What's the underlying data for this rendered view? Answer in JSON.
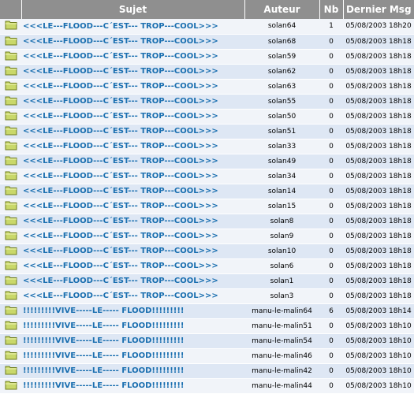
{
  "header": {
    "sujet": "Sujet",
    "auteur": "Auteur",
    "nb": "Nb",
    "dernier": "Dernier Msg"
  },
  "rows": [
    {
      "subject": "<<<LE---FLOOD---C´EST--- TROP---COOL>>>",
      "author": "solan64",
      "nb": "1",
      "date": "05/08/2003 18h20"
    },
    {
      "subject": "<<<LE---FLOOD---C´EST--- TROP---COOL>>>",
      "author": "solan68",
      "nb": "0",
      "date": "05/08/2003 18h18"
    },
    {
      "subject": "<<<LE---FLOOD---C´EST--- TROP---COOL>>>",
      "author": "solan59",
      "nb": "0",
      "date": "05/08/2003 18h18"
    },
    {
      "subject": "<<<LE---FLOOD---C´EST--- TROP---COOL>>>",
      "author": "solan62",
      "nb": "0",
      "date": "05/08/2003 18h18"
    },
    {
      "subject": "<<<LE---FLOOD---C´EST--- TROP---COOL>>>",
      "author": "solan63",
      "nb": "0",
      "date": "05/08/2003 18h18"
    },
    {
      "subject": "<<<LE---FLOOD---C´EST--- TROP---COOL>>>",
      "author": "solan55",
      "nb": "0",
      "date": "05/08/2003 18h18"
    },
    {
      "subject": "<<<LE---FLOOD---C´EST--- TROP---COOL>>>",
      "author": "solan50",
      "nb": "0",
      "date": "05/08/2003 18h18"
    },
    {
      "subject": "<<<LE---FLOOD---C´EST--- TROP---COOL>>>",
      "author": "solan51",
      "nb": "0",
      "date": "05/08/2003 18h18"
    },
    {
      "subject": "<<<LE---FLOOD---C´EST--- TROP---COOL>>>",
      "author": "solan33",
      "nb": "0",
      "date": "05/08/2003 18h18"
    },
    {
      "subject": "<<<LE---FLOOD---C´EST--- TROP---COOL>>>",
      "author": "solan49",
      "nb": "0",
      "date": "05/08/2003 18h18"
    },
    {
      "subject": "<<<LE---FLOOD---C´EST--- TROP---COOL>>>",
      "author": "solan34",
      "nb": "0",
      "date": "05/08/2003 18h18"
    },
    {
      "subject": "<<<LE---FLOOD---C´EST--- TROP---COOL>>>",
      "author": "solan14",
      "nb": "0",
      "date": "05/08/2003 18h18"
    },
    {
      "subject": "<<<LE---FLOOD---C´EST--- TROP---COOL>>>",
      "author": "solan15",
      "nb": "0",
      "date": "05/08/2003 18h18"
    },
    {
      "subject": "<<<LE---FLOOD---C´EST--- TROP---COOL>>>",
      "author": "solan8",
      "nb": "0",
      "date": "05/08/2003 18h18"
    },
    {
      "subject": "<<<LE---FLOOD---C´EST--- TROP---COOL>>>",
      "author": "solan9",
      "nb": "0",
      "date": "05/08/2003 18h18"
    },
    {
      "subject": "<<<LE---FLOOD---C´EST--- TROP---COOL>>>",
      "author": "solan10",
      "nb": "0",
      "date": "05/08/2003 18h18"
    },
    {
      "subject": "<<<LE---FLOOD---C´EST--- TROP---COOL>>>",
      "author": "solan6",
      "nb": "0",
      "date": "05/08/2003 18h18"
    },
    {
      "subject": "<<<LE---FLOOD---C´EST--- TROP---COOL>>>",
      "author": "solan1",
      "nb": "0",
      "date": "05/08/2003 18h18"
    },
    {
      "subject": "<<<LE---FLOOD---C´EST--- TROP---COOL>>>",
      "author": "solan3",
      "nb": "0",
      "date": "05/08/2003 18h18"
    },
    {
      "subject": "!!!!!!!!!VIVE-----LE----- FLOOD!!!!!!!!!",
      "author": "manu-le-malin64",
      "nb": "6",
      "date": "05/08/2003 18h14"
    },
    {
      "subject": "!!!!!!!!!VIVE-----LE----- FLOOD!!!!!!!!!",
      "author": "manu-le-malin51",
      "nb": "0",
      "date": "05/08/2003 18h10"
    },
    {
      "subject": "!!!!!!!!!VIVE-----LE----- FLOOD!!!!!!!!!",
      "author": "manu-le-malin54",
      "nb": "0",
      "date": "05/08/2003 18h10"
    },
    {
      "subject": "!!!!!!!!!VIVE-----LE----- FLOOD!!!!!!!!!",
      "author": "manu-le-malin46",
      "nb": "0",
      "date": "05/08/2003 18h10"
    },
    {
      "subject": "!!!!!!!!!VIVE-----LE----- FLOOD!!!!!!!!!",
      "author": "manu-le-malin42",
      "nb": "0",
      "date": "05/08/2003 18h10"
    },
    {
      "subject": "!!!!!!!!!VIVE-----LE----- FLOOD!!!!!!!!!",
      "author": "manu-le-malin44",
      "nb": "0",
      "date": "05/08/2003 18h10"
    }
  ],
  "colors": {
    "header_bg": "#8f8f8f",
    "row_odd": "#f1f4f9",
    "row_even": "#dee7f4",
    "link": "#1a6fb0",
    "folder": "#b7c94a"
  },
  "icons": {
    "row_icon": "folder-icon"
  }
}
